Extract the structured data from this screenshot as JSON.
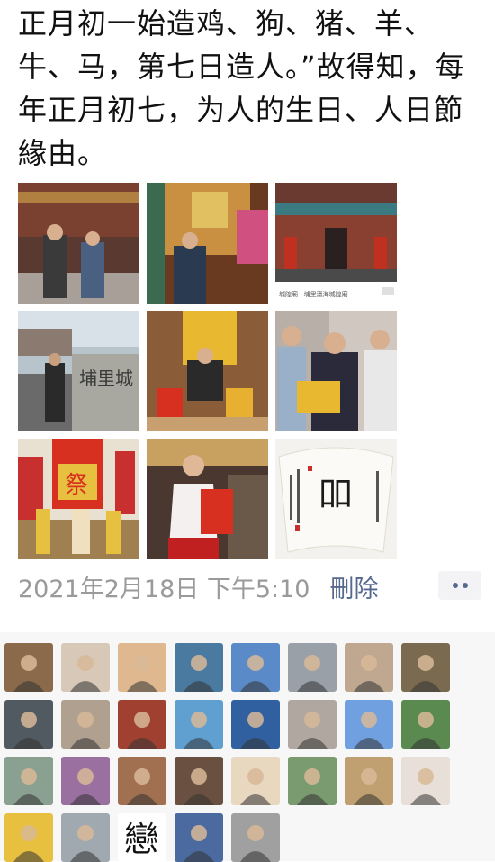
{
  "post": {
    "text": "正月初一始造鸡、狗、猪、羊、牛、马，第七日造人。”故得知，每年正月初七，为人的生日、人日節緣由。"
  },
  "photos": [
    {
      "name": "photo-temple-couple",
      "bg": "#8a6a4e"
    },
    {
      "name": "photo-altar-man",
      "bg": "#7a4a2a"
    },
    {
      "name": "photo-temple-building",
      "bg": "#6a3a2a",
      "caption": "城隍廟 · 埔里瀛海城隍廟"
    },
    {
      "name": "photo-stone-sign",
      "bg": "#b8c4cc",
      "sign": "埔里城"
    },
    {
      "name": "photo-gift-boxes",
      "bg": "#8a5a3a"
    },
    {
      "name": "photo-three-men",
      "bg": "#c8c0b0"
    },
    {
      "name": "photo-parade-banners",
      "bg": "#c83030",
      "banner": "祭"
    },
    {
      "name": "photo-woman-host",
      "bg": "#6a5040"
    },
    {
      "name": "photo-calligraphy-fan",
      "bg": "#f0eee8",
      "glyph": "吅"
    }
  ],
  "meta": {
    "timestamp": "2021年2月18日 下午5:10",
    "delete_label": "刪除"
  },
  "likes": {
    "avatars": [
      "#8a6a4a",
      "#d8c8b8",
      "#e0b890",
      "#4a7aa0",
      "#5a8ac8",
      "#9aa0a8",
      "#c0a890",
      "#7a6a50",
      "#505a60",
      "#b0a090",
      "#a04030",
      "#60a0d0",
      "#3060a0",
      "#b0a8a0",
      "#70a0e0",
      "#5a8a50",
      "#8aa090",
      "#9a70a0",
      "#a07050",
      "#6a5040",
      "#e8d8c0",
      "#7a9a70",
      "#c0a070",
      "#e8e0d8",
      "#e8c040",
      "#a0a8b0",
      "#ffffff",
      "#4a6aa0",
      "#a0a0a0"
    ],
    "glyph_avatar_text": "戀"
  }
}
